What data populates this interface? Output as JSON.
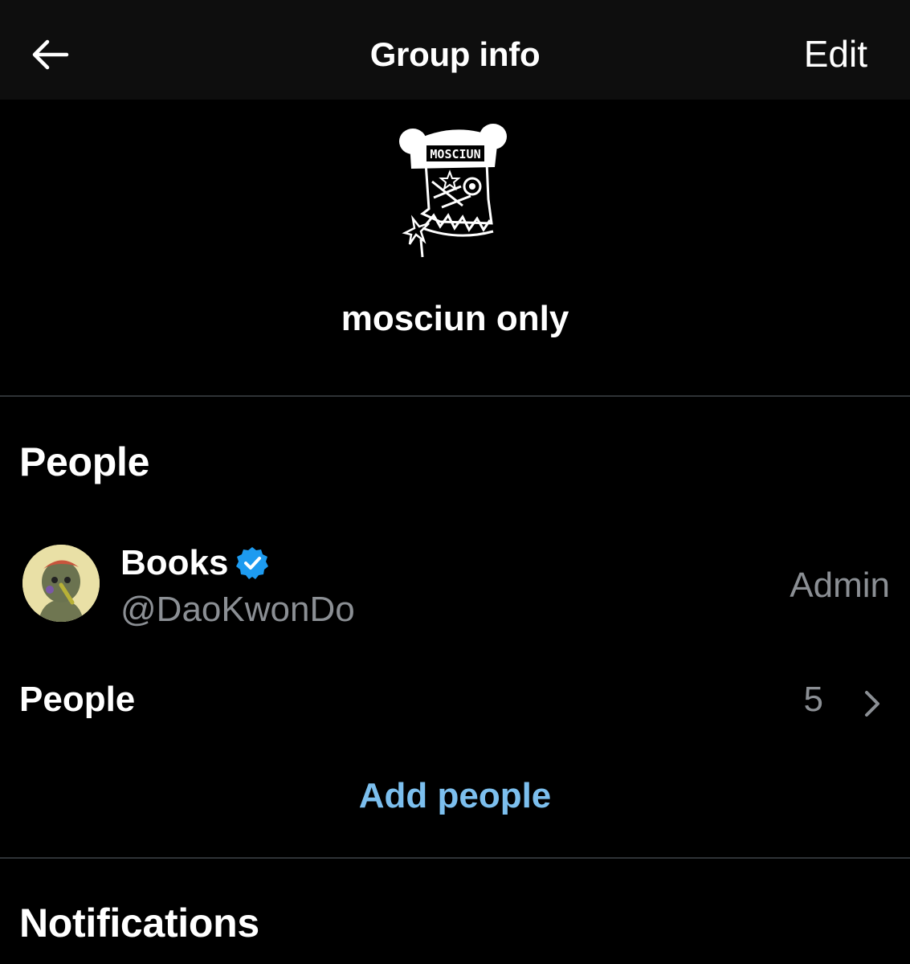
{
  "header": {
    "title": "Group info",
    "edit_label": "Edit"
  },
  "group": {
    "name": "mosciun only",
    "avatar_text": "MOSCIUN"
  },
  "people_section": {
    "heading": "People",
    "members": [
      {
        "name": "Books",
        "handle": "@DaoKwonDo",
        "role": "Admin",
        "verified": true
      }
    ],
    "people_row_label": "People",
    "people_count": "5",
    "add_people_label": "Add people"
  },
  "notifications_section": {
    "heading": "Notifications"
  },
  "colors": {
    "background": "#000000",
    "header_bg": "#0e0e0e",
    "secondary_text": "#8b8f94",
    "accent_link": "#7cbfee",
    "verified_blue": "#1d9bf0",
    "divider": "#2f3336"
  }
}
